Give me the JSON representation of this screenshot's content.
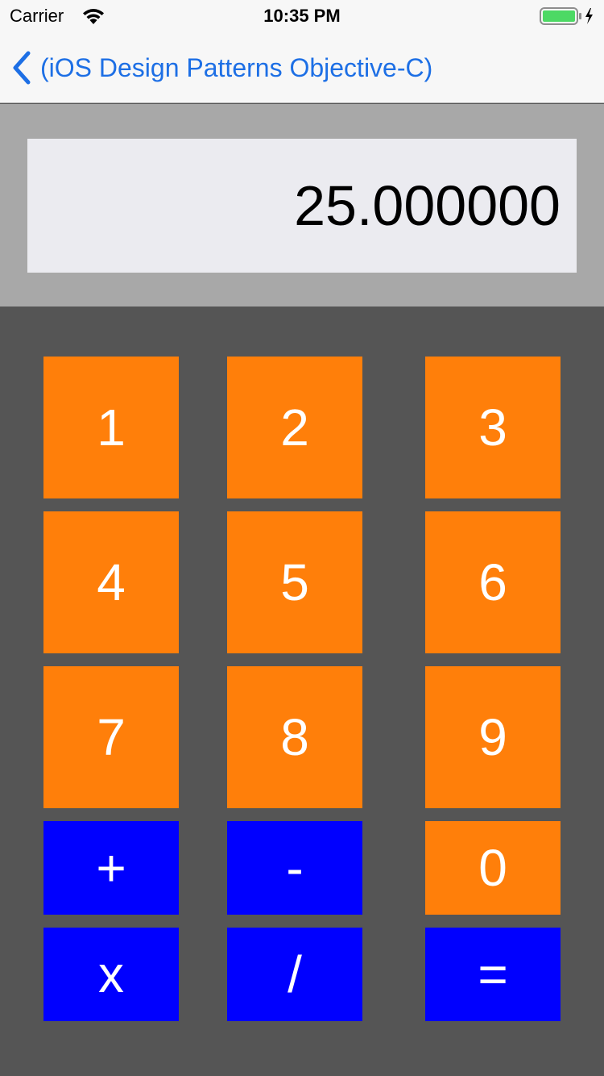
{
  "status_bar": {
    "carrier": "Carrier",
    "time": "10:35 PM",
    "wifi_icon": "wifi-icon",
    "battery_icon": "battery-charging-icon",
    "battery_color": "#4cd964"
  },
  "nav_bar": {
    "back_label": "(iOS Design Patterns Objective-C)",
    "back_icon": "chevron-left-icon",
    "tint_color": "#1d6fe5"
  },
  "display": {
    "value": "25.000000"
  },
  "keypad": {
    "digit_color": "#ff7f0a",
    "operator_color": "#0000ff",
    "keys": {
      "one": "1",
      "two": "2",
      "three": "3",
      "four": "4",
      "five": "5",
      "six": "6",
      "seven": "7",
      "eight": "8",
      "nine": "9",
      "plus": "+",
      "minus": "-",
      "zero": "0",
      "multiply": "x",
      "divide": "/",
      "equals": "="
    }
  }
}
